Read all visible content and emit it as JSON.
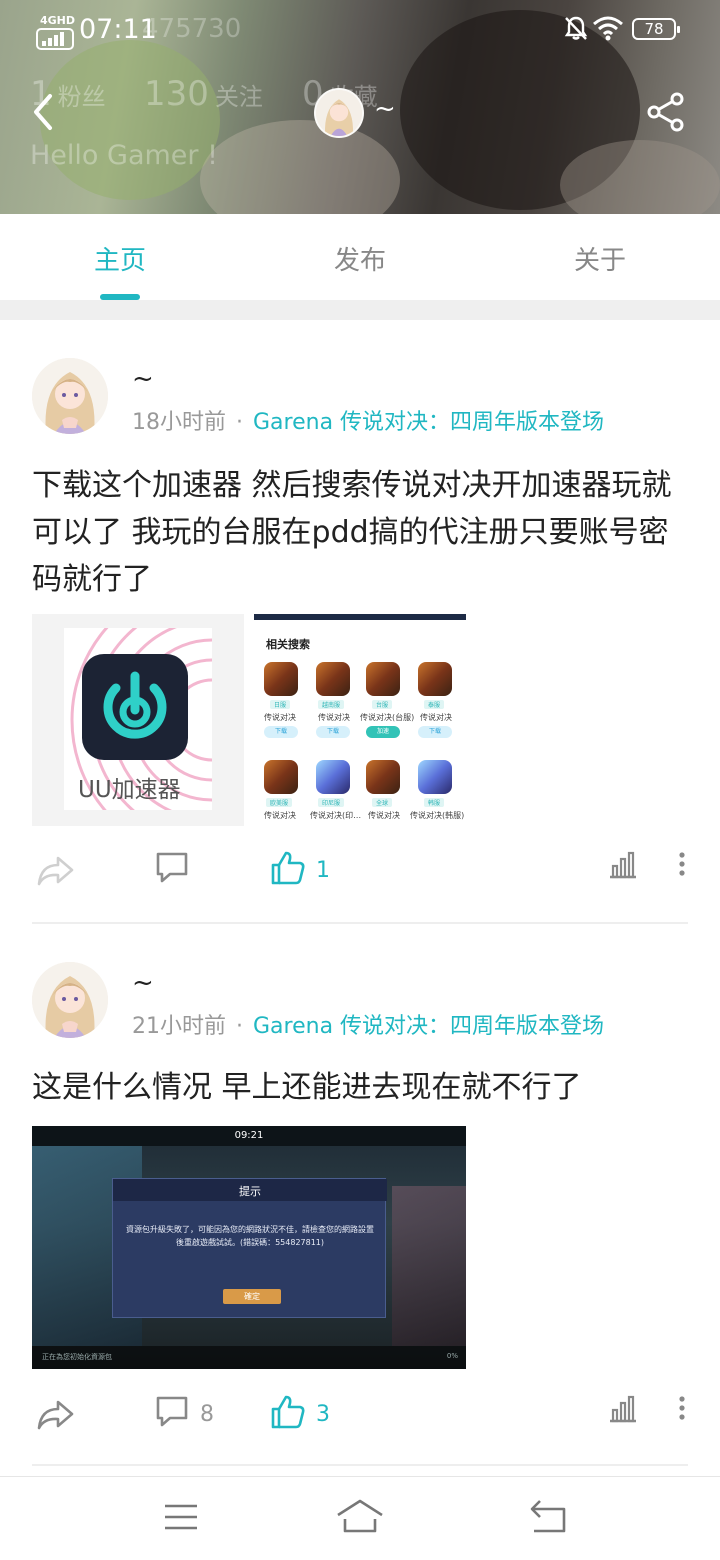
{
  "status_bar": {
    "network": "4GHD",
    "time": "07:11",
    "ghost_number": "475730",
    "battery": "78",
    "icons": [
      "signal-icon",
      "mute-bell-icon",
      "wifi-icon",
      "battery-icon"
    ]
  },
  "profile": {
    "stats": [
      {
        "value": "1",
        "label": "粉丝"
      },
      {
        "value": "130",
        "label": "关注"
      },
      {
        "value": "0",
        "label": "收藏"
      }
    ],
    "bio": "Hello Gamer !",
    "name": "~"
  },
  "tabs": [
    {
      "label": "主页",
      "active": true
    },
    {
      "label": "发布",
      "active": false
    },
    {
      "label": "关于",
      "active": false
    }
  ],
  "posts": [
    {
      "author": "~",
      "time": "18小时前",
      "separator": "·",
      "topic": "Garena 传说对决：四周年版本登场",
      "text": "下载这个加速器 然后搜索传说对决开加速器玩就可以了 我玩的台服在pdd搞的代注册只要账号密码就行了",
      "image_app_label": "UU加速器",
      "search_title": "相关搜索",
      "search_results": [
        {
          "tag": "日服",
          "name": "传说对决",
          "button": "下载",
          "installed": false
        },
        {
          "tag": "越南服",
          "name": "传说对决",
          "button": "下载",
          "installed": false
        },
        {
          "tag": "台服",
          "name": "传说对决(台服)",
          "button": "加速",
          "installed": true
        },
        {
          "tag": "泰服",
          "name": "传说对决",
          "button": "下载",
          "installed": false
        },
        {
          "tag": "欧美服",
          "name": "传说对决",
          "button": "",
          "installed": false
        },
        {
          "tag": "印尼服",
          "name": "传说对决(印…",
          "button": "",
          "installed": false
        },
        {
          "tag": "全球",
          "name": "传说对决",
          "button": "",
          "installed": false
        },
        {
          "tag": "韩服",
          "name": "传说对决(韩服)",
          "button": "",
          "installed": false
        }
      ],
      "comments": "",
      "likes": "1"
    },
    {
      "author": "~",
      "time": "21小时前",
      "separator": "·",
      "topic": "Garena 传说对决：四周年版本登场",
      "text": "这是什么情况 早上还能进去现在就不行了",
      "screenshot_time": "09:21",
      "dialog_title": "提示",
      "dialog_message": "資源包升級失敗了，可能因為您的網路狀況不佳，請檢查您的網路設置後重啟遊戲試試。(錯誤碼：554827811)",
      "dialog_button": "確定",
      "footer_left": "正在為您初始化資源包",
      "footer_right": "0%",
      "comments": "8",
      "likes": "3"
    }
  ],
  "colors": {
    "accent": "#20b7c2",
    "text": "#222222",
    "muted": "#999999"
  }
}
